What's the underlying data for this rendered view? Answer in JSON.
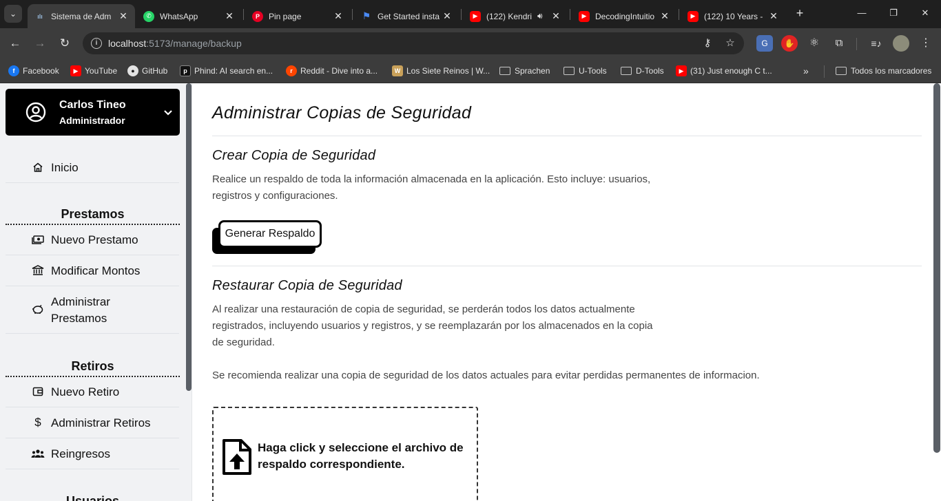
{
  "browser": {
    "tabs": [
      {
        "label": "Sistema de Adm",
        "fav_color": "#3c3c3c",
        "active": true
      },
      {
        "label": "WhatsApp",
        "fav_color": "#25d366"
      },
      {
        "label": "Pin page",
        "fav_color": "#e60023"
      },
      {
        "label": "Get Started insta",
        "fav_color": "#1a73e8"
      },
      {
        "label": "(122) Kendri",
        "fav_color": "#ff0000"
      },
      {
        "label": "DecodingIntuitio",
        "fav_color": "#ff0000"
      },
      {
        "label": "(122) 10 Years -",
        "fav_color": "#ff0000"
      }
    ],
    "url_host": "localhost",
    "url_rest": ":5173/manage/backup",
    "bookmarks": [
      {
        "label": "Facebook",
        "icon": "facebook-icon",
        "color": "#1877f2",
        "glyph": "f"
      },
      {
        "label": "YouTube",
        "icon": "youtube-icon",
        "color": "#ff0000",
        "glyph": "▶"
      },
      {
        "label": "GitHub",
        "icon": "github-icon",
        "color": "#e3e3e3",
        "glyph": "●"
      },
      {
        "label": "Phind: AI search en...",
        "icon": "phind-icon",
        "color": "#111111",
        "glyph": "p"
      },
      {
        "label": "Reddit - Dive into a...",
        "icon": "reddit-icon",
        "color": "#ff4500",
        "glyph": "r"
      },
      {
        "label": "Los Siete Reinos | W...",
        "icon": "wiki-icon",
        "color": "#c9a15a",
        "glyph": "W"
      },
      {
        "label": "Sprachen",
        "icon": "folder-icon",
        "folder": true
      },
      {
        "label": "U-Tools",
        "icon": "folder-icon",
        "folder": true
      },
      {
        "label": "D-Tools",
        "icon": "folder-icon",
        "folder": true
      },
      {
        "label": "(31) Just enough C t...",
        "icon": "youtube-icon",
        "color": "#ff0000",
        "glyph": "▶"
      }
    ],
    "all_bookmarks": "Todos los marcadores"
  },
  "sidebar": {
    "user_name": "Carlos Tineo",
    "user_role": "Administrador",
    "home": "Inicio",
    "sections": {
      "prestamos": "Prestamos",
      "retiros": "Retiros",
      "usuarios": "Usuarios"
    },
    "prestamos_items": [
      "Nuevo Prestamo",
      "Modificar Montos",
      "Administrar Prestamos"
    ],
    "retiros_items": [
      "Nuevo Retiro",
      "Administrar Retiros",
      "Reingresos"
    ]
  },
  "main": {
    "title": "Administrar Copias de Seguridad",
    "create": {
      "heading": "Crear Copia de Seguridad",
      "desc_1": "Realice un respaldo de toda la información almacenada en la aplicación. Esto incluye: usuarios,",
      "desc_2": "registros y configuraciones.",
      "button": "Generar Respaldo"
    },
    "restore": {
      "heading": "Restaurar Copia de Seguridad",
      "desc_1": "Al realizar una restauración de copia de seguridad, se perderán todos los datos actualmente",
      "desc_2": "registrados, incluyendo usuarios y registros, y se reemplazarán por los almacenados en la copia",
      "desc_3": "de seguridad.",
      "recommendation": "Se recomienda realizar una copia de seguridad de los datos actuales para evitar perdidas permanentes de informacion.",
      "drop_text_1": "Haga click y seleccione el archivo de",
      "drop_text_2": "respaldo correspondiente."
    }
  }
}
